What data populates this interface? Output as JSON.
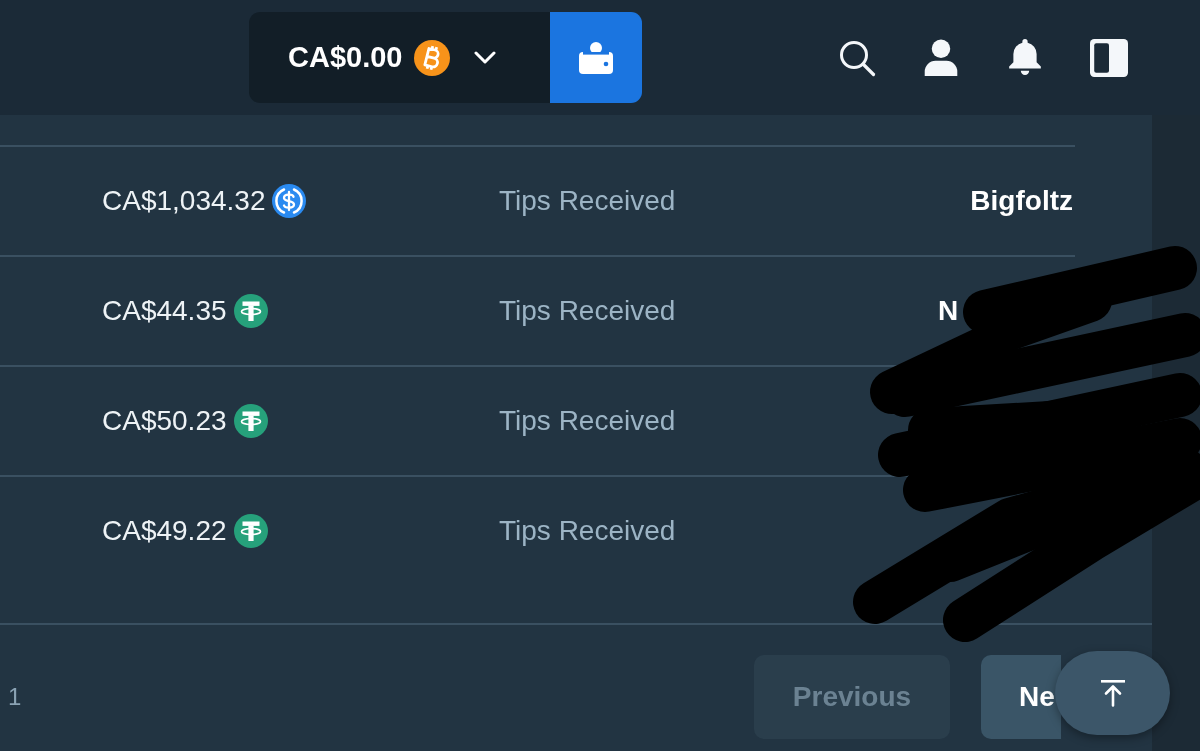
{
  "header": {
    "balance": {
      "amount": "CA$0.00",
      "coin": {
        "kind": "btc"
      }
    }
  },
  "transactions": [
    {
      "amount": "CA$1,034.32",
      "coin": {
        "kind": "usdc"
      },
      "type": "Tips Received",
      "user": "Bigfoltz",
      "user_redacted": false
    },
    {
      "amount": "CA$44.35",
      "coin": {
        "kind": "usdt"
      },
      "type": "Tips Received",
      "user": "N",
      "user_redacted": true
    },
    {
      "amount": "CA$50.23",
      "coin": {
        "kind": "usdt"
      },
      "type": "Tips Received",
      "user_redacted": true
    },
    {
      "amount": "CA$49.22",
      "coin": {
        "kind": "usdt"
      },
      "type": "Tips Received",
      "user_redacted": true
    }
  ],
  "pagination": {
    "page": "1",
    "previous": {
      "label": "Previous",
      "disabled": true
    },
    "next": {
      "label": "Ne",
      "disabled": false
    }
  }
}
